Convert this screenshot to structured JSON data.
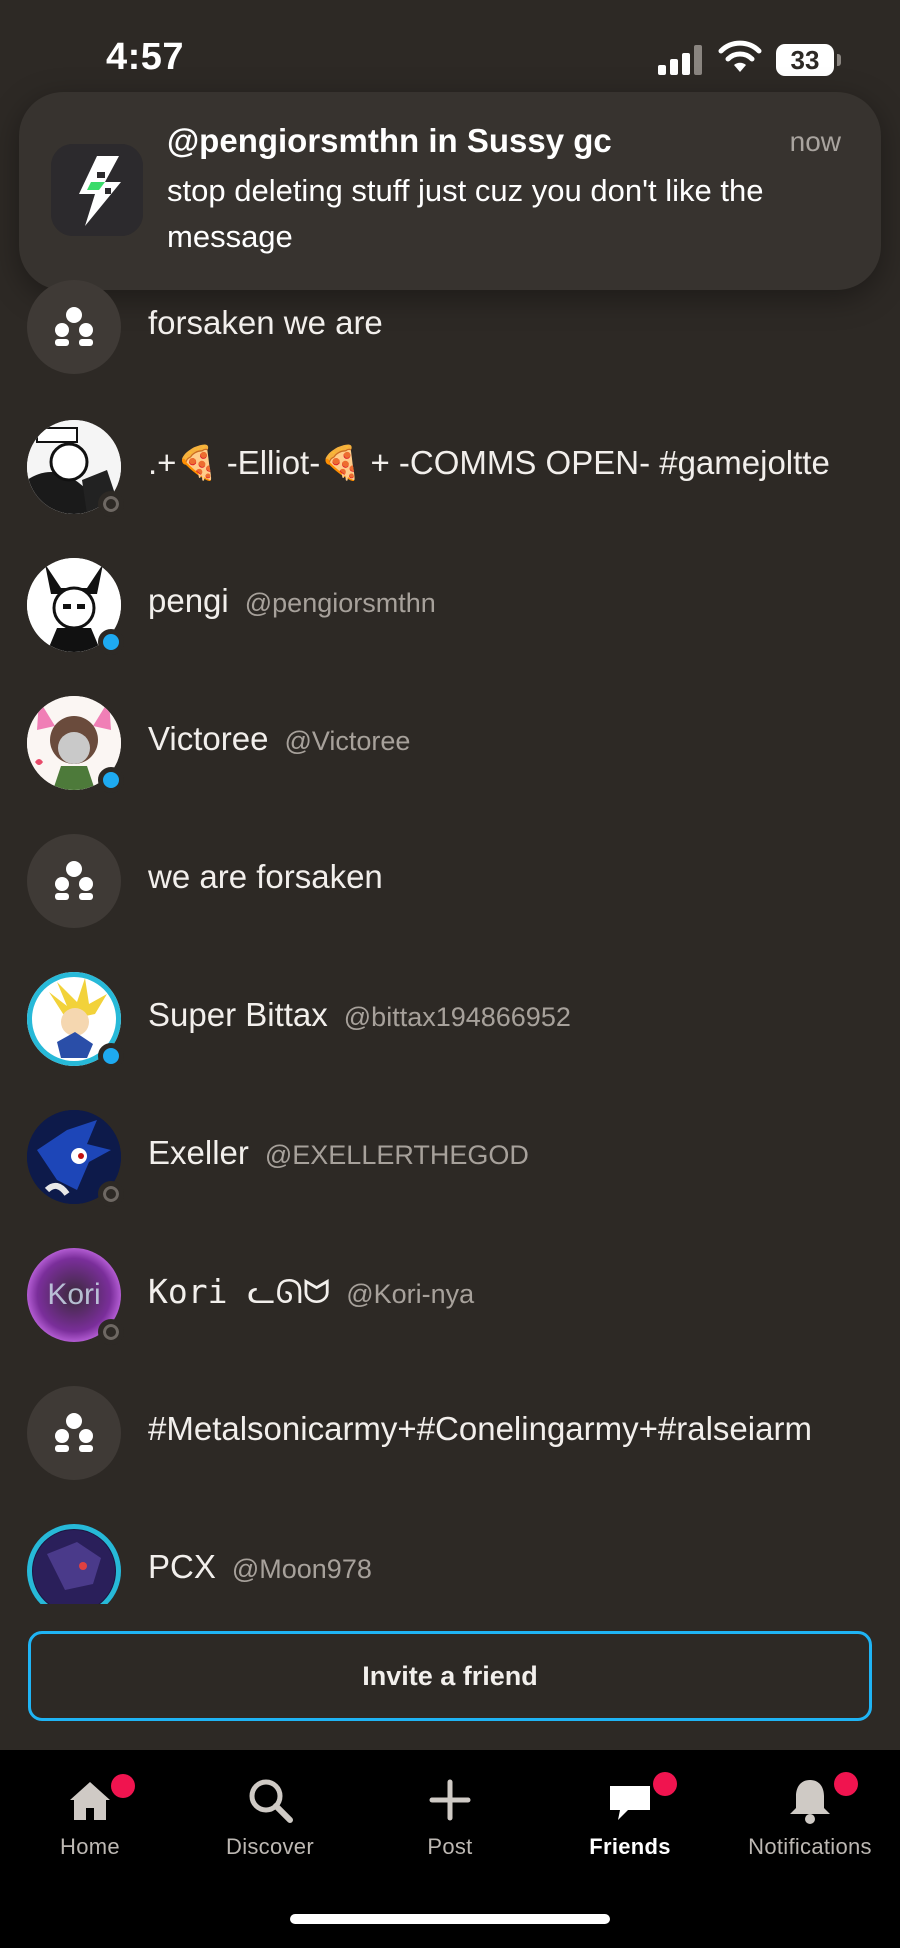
{
  "status": {
    "time": "4:57",
    "battery": "33"
  },
  "notification": {
    "title": "@pengiorsmthn in Sussy gc",
    "time": "now",
    "body": "stop deleting stuff just cuz you don't like the message"
  },
  "friends": [
    {
      "name": "forsaken we are",
      "handle": "",
      "type": "group"
    },
    {
      "name": ".+🍕 -Elliot-🍕 + -COMMS OPEN- #gamejoltte",
      "handle": "",
      "status": "offline"
    },
    {
      "name": "pengi",
      "handle": "@pengiorsmthn",
      "status": "online"
    },
    {
      "name": "Victoree",
      "handle": "@Victoree",
      "status": "online"
    },
    {
      "name": "we are forsaken",
      "handle": "",
      "type": "group"
    },
    {
      "name": "Super Bittax",
      "handle": "@bittax194866952",
      "status": "online"
    },
    {
      "name": "Exeller",
      "handle": "@EXELLERTHEGOD",
      "status": "offline"
    },
    {
      "name": "Kori ᓚᘏᗢ",
      "handle": "@Kori-nya",
      "status": "offline"
    },
    {
      "name": "#Metalsonicarmy+#Conelingarmy+#ralseiarm",
      "handle": "",
      "type": "group"
    },
    {
      "name": "PCX",
      "handle": "@Moon978",
      "status": "none"
    }
  ],
  "invite_label": "Invite a friend",
  "tabs": {
    "home": "Home",
    "discover": "Discover",
    "post": "Post",
    "friends": "Friends",
    "notifications": "Notifications"
  },
  "colors": {
    "accent": "#1fb4f5",
    "badge": "#f0144f",
    "online": "#1eaaf1",
    "background": "#2d2925"
  }
}
